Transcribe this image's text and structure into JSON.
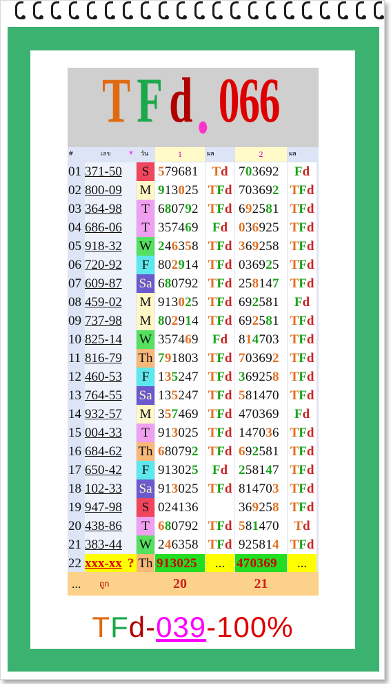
{
  "banner": {
    "parts": [
      {
        "text": "T",
        "color": "#e06a10"
      },
      {
        "text": "F",
        "color": "#1aa84a"
      },
      {
        "text": "d",
        "color": "#b00000"
      },
      {
        "text": ".",
        "color": "#ff33cc"
      },
      {
        "text": "066",
        "color": "#dd0000"
      }
    ]
  },
  "columns": {
    "num": "#",
    "pair": "เลข",
    "star": "*",
    "day": "วัน",
    "set1": "1",
    "res1": "ผล",
    "set2": "2",
    "res2": "ผล"
  },
  "rows": [
    {
      "n": "01",
      "pair": "371-50",
      "day": "S",
      "day_color": "#f0455c",
      "a": [
        [
          "o",
          "5"
        ],
        [
          "k",
          "79681"
        ]
      ],
      "ra": "Td",
      "b": [
        [
          "k",
          "7"
        ],
        [
          "g",
          "0"
        ],
        [
          "k",
          "3692"
        ]
      ],
      "rb": "Fd"
    },
    {
      "n": "02",
      "pair": "800-09",
      "day": "M",
      "day_color": "#fff7c6",
      "a": [
        [
          "g",
          "9"
        ],
        [
          "k",
          "13"
        ],
        [
          "o",
          "0"
        ],
        [
          "k",
          "25"
        ]
      ],
      "ra": "TFd",
      "b": [
        [
          "k",
          "70369"
        ],
        [
          "g",
          "2"
        ]
      ],
      "rb": "TFd"
    },
    {
      "n": "03",
      "pair": "364-98",
      "day": "T",
      "day_color": "#f0a0f0",
      "a": [
        [
          "k",
          "6"
        ],
        [
          "g",
          "8"
        ],
        [
          "k",
          "07"
        ],
        [
          "g",
          "9"
        ],
        [
          "k",
          "2"
        ]
      ],
      "ra": "TFd",
      "b": [
        [
          "k",
          "6"
        ],
        [
          "o",
          "9"
        ],
        [
          "k",
          "25"
        ],
        [
          "g",
          "8"
        ],
        [
          "k",
          "1"
        ]
      ],
      "rb": "TFd"
    },
    {
      "n": "04",
      "pair": "686-06",
      "day": "T",
      "day_color": "#f0a0f0",
      "a": [
        [
          "k",
          "3574"
        ],
        [
          "g",
          "6"
        ],
        [
          "k",
          "9"
        ]
      ],
      "ra": "Fd",
      "b": [
        [
          "o",
          "0"
        ],
        [
          "k",
          "3"
        ],
        [
          "o",
          "6"
        ],
        [
          "k",
          "925"
        ]
      ],
      "rb": "TFd"
    },
    {
      "n": "05",
      "pair": "918-32",
      "day": "W",
      "day_color": "#55e060",
      "a": [
        [
          "g",
          "2"
        ],
        [
          "k",
          "4"
        ],
        [
          "o",
          "6"
        ],
        [
          "k",
          "3"
        ],
        [
          "o",
          "5"
        ],
        [
          "k",
          "8"
        ]
      ],
      "ra": "TFd",
      "b": [
        [
          "o",
          "3"
        ],
        [
          "k",
          "6"
        ],
        [
          "o",
          "9"
        ],
        [
          "k",
          "258"
        ]
      ],
      "rb": "TFd"
    },
    {
      "n": "06",
      "pair": "720-92",
      "day": "F",
      "day_color": "#5ee8ee",
      "a": [
        [
          "k",
          "80"
        ],
        [
          "o",
          "2"
        ],
        [
          "g",
          "9"
        ],
        [
          "k",
          "14"
        ]
      ],
      "ra": "TFd",
      "b": [
        [
          "k",
          "0369"
        ],
        [
          "g",
          "2"
        ],
        [
          "k",
          "5"
        ]
      ],
      "rb": "TFd"
    },
    {
      "n": "07",
      "pair": "609-87",
      "day": "Sa",
      "day_color": "#6a5acd",
      "a": [
        [
          "k",
          "6"
        ],
        [
          "g",
          "8"
        ],
        [
          "k",
          "0792"
        ]
      ],
      "ra": "TFd",
      "b": [
        [
          "k",
          "25"
        ],
        [
          "o",
          "8"
        ],
        [
          "k",
          "14"
        ],
        [
          "g",
          "7"
        ]
      ],
      "rb": "TFd"
    },
    {
      "n": "08",
      "pair": "459-02",
      "day": "M",
      "day_color": "#fff7c6",
      "a": [
        [
          "k",
          "913"
        ],
        [
          "o",
          "0"
        ],
        [
          "g",
          "2"
        ],
        [
          "k",
          "5"
        ]
      ],
      "ra": "TFd",
      "b": [
        [
          "k",
          "69"
        ],
        [
          "g",
          "2"
        ],
        [
          "k",
          "581"
        ]
      ],
      "rb": "Fd"
    },
    {
      "n": "09",
      "pair": "737-98",
      "day": "M",
      "day_color": "#fff7c6",
      "a": [
        [
          "g",
          "8"
        ],
        [
          "k",
          "0"
        ],
        [
          "o",
          "2"
        ],
        [
          "k",
          "9"
        ],
        [
          "g",
          "1"
        ],
        [
          "k",
          "4"
        ]
      ],
      "ra": "TFd",
      "b": [
        [
          "k",
          "69"
        ],
        [
          "o",
          "2"
        ],
        [
          "k",
          "5"
        ],
        [
          "g",
          "8"
        ],
        [
          "k",
          "1"
        ]
      ],
      "rb": "TFd"
    },
    {
      "n": "10",
      "pair": "825-14",
      "day": "W",
      "day_color": "#55e060",
      "a": [
        [
          "k",
          "3574"
        ],
        [
          "o",
          "6"
        ],
        [
          "k",
          "9"
        ]
      ],
      "ra": "Fd",
      "b": [
        [
          "k",
          "8"
        ],
        [
          "o",
          "1"
        ],
        [
          "g",
          "4"
        ],
        [
          "k",
          "703"
        ]
      ],
      "rb": "TFd"
    },
    {
      "n": "11",
      "pair": "816-79",
      "day": "Th",
      "day_color": "#f8b878",
      "a": [
        [
          "g",
          "7"
        ],
        [
          "o",
          "9"
        ],
        [
          "k",
          "1803"
        ]
      ],
      "ra": "TFd",
      "b": [
        [
          "o",
          "7"
        ],
        [
          "k",
          "0369"
        ],
        [
          "o",
          "2"
        ]
      ],
      "rb": "TFd"
    },
    {
      "n": "12",
      "pair": "460-53",
      "day": "F",
      "day_color": "#5ee8ee",
      "a": [
        [
          "k",
          "1"
        ],
        [
          "o",
          "3"
        ],
        [
          "g",
          "5"
        ],
        [
          "k",
          "247"
        ]
      ],
      "ra": "TFd",
      "b": [
        [
          "g",
          "3"
        ],
        [
          "k",
          "6925"
        ],
        [
          "o",
          "8"
        ]
      ],
      "rb": "TFd"
    },
    {
      "n": "13",
      "pair": "764-55",
      "day": "Sa",
      "day_color": "#6a5acd",
      "a": [
        [
          "k",
          "13"
        ],
        [
          "o",
          "5"
        ],
        [
          "k",
          "247"
        ]
      ],
      "ra": "TFd",
      "b": [
        [
          "o",
          "5"
        ],
        [
          "k",
          "81470"
        ]
      ],
      "rb": "TFd"
    },
    {
      "n": "14",
      "pair": "932-57",
      "day": "M",
      "day_color": "#fff7c6",
      "a": [
        [
          "k",
          "3"
        ],
        [
          "o",
          "5"
        ],
        [
          "g",
          "7"
        ],
        [
          "k",
          "469"
        ]
      ],
      "ra": "TFd",
      "b": [
        [
          "k",
          "470369"
        ]
      ],
      "rb": "Fd"
    },
    {
      "n": "15",
      "pair": "004-33",
      "day": "T",
      "day_color": "#f0a0f0",
      "a": [
        [
          "k",
          "91"
        ],
        [
          "o",
          "3"
        ],
        [
          "k",
          "025"
        ]
      ],
      "ra": "TFd",
      "b": [
        [
          "k",
          "1470"
        ],
        [
          "o",
          "3"
        ],
        [
          "k",
          "6"
        ]
      ],
      "rb": "TFd"
    },
    {
      "n": "16",
      "pair": "684-62",
      "day": "Th",
      "day_color": "#f8b878",
      "a": [
        [
          "o",
          "6"
        ],
        [
          "k",
          "8079"
        ],
        [
          "g",
          "2"
        ]
      ],
      "ra": "TFd",
      "b": [
        [
          "o",
          "6"
        ],
        [
          "k",
          "9"
        ],
        [
          "g",
          "2"
        ],
        [
          "k",
          "581"
        ]
      ],
      "rb": "TFd"
    },
    {
      "n": "17",
      "pair": "650-42",
      "day": "F",
      "day_color": "#5ee8ee",
      "a": [
        [
          "k",
          "91302"
        ],
        [
          "g",
          "5"
        ]
      ],
      "ra": "Fd",
      "b": [
        [
          "g",
          "2"
        ],
        [
          "k",
          "581"
        ],
        [
          "g",
          "4"
        ],
        [
          "k",
          "7"
        ]
      ],
      "rb": "TFd"
    },
    {
      "n": "18",
      "pair": "102-33",
      "day": "Sa",
      "day_color": "#6a5acd",
      "a": [
        [
          "k",
          "91"
        ],
        [
          "o",
          "3"
        ],
        [
          "k",
          "025"
        ]
      ],
      "ra": "TFd",
      "b": [
        [
          "k",
          "81470"
        ],
        [
          "o",
          "3"
        ]
      ],
      "rb": "TFd"
    },
    {
      "n": "19",
      "pair": "947-98",
      "day": "S",
      "day_color": "#f0455c",
      "a": [
        [
          "k",
          "024136"
        ]
      ],
      "ra": "",
      "b": [
        [
          "k",
          "36"
        ],
        [
          "o",
          "9"
        ],
        [
          "k",
          "25"
        ],
        [
          "o",
          "8"
        ]
      ],
      "rb": "TFd"
    },
    {
      "n": "20",
      "pair": "438-86",
      "day": "T",
      "day_color": "#f0a0f0",
      "a": [
        [
          "o",
          "6"
        ],
        [
          "g",
          "8"
        ],
        [
          "k",
          "0792"
        ]
      ],
      "ra": "TFd",
      "b": [
        [
          "o",
          "5"
        ],
        [
          "k",
          "8"
        ],
        [
          "g",
          "1"
        ],
        [
          "k",
          "470"
        ]
      ],
      "rb": "Td"
    },
    {
      "n": "21",
      "pair": "383-44",
      "day": "W",
      "day_color": "#55e060",
      "a": [
        [
          "k",
          "2"
        ],
        [
          "o",
          "4"
        ],
        [
          "k",
          "6358"
        ]
      ],
      "ra": "TFd",
      "b": [
        [
          "k",
          "92581"
        ],
        [
          "o",
          "4"
        ]
      ],
      "rb": "TFd"
    }
  ],
  "pending_row": {
    "n": "22",
    "pair": "xxx-xx",
    "mark": "?",
    "day": "Th",
    "a": "913025",
    "ra": "...",
    "b": "470369",
    "rb": "..."
  },
  "footer": {
    "dots": "...",
    "label": "ถูก",
    "count1": "20",
    "count2": "21"
  },
  "slogan": {
    "parts": [
      {
        "text": "T",
        "color": "#e06a10"
      },
      {
        "text": "F",
        "color": "#1aa84a"
      },
      {
        "text": "d",
        "color": "#b00000"
      },
      {
        "text": "-",
        "color": "#b00000"
      },
      {
        "text": "039",
        "color": "#ff00ff",
        "underline": true
      },
      {
        "text": "-100%",
        "color": "#dd0000"
      }
    ]
  }
}
